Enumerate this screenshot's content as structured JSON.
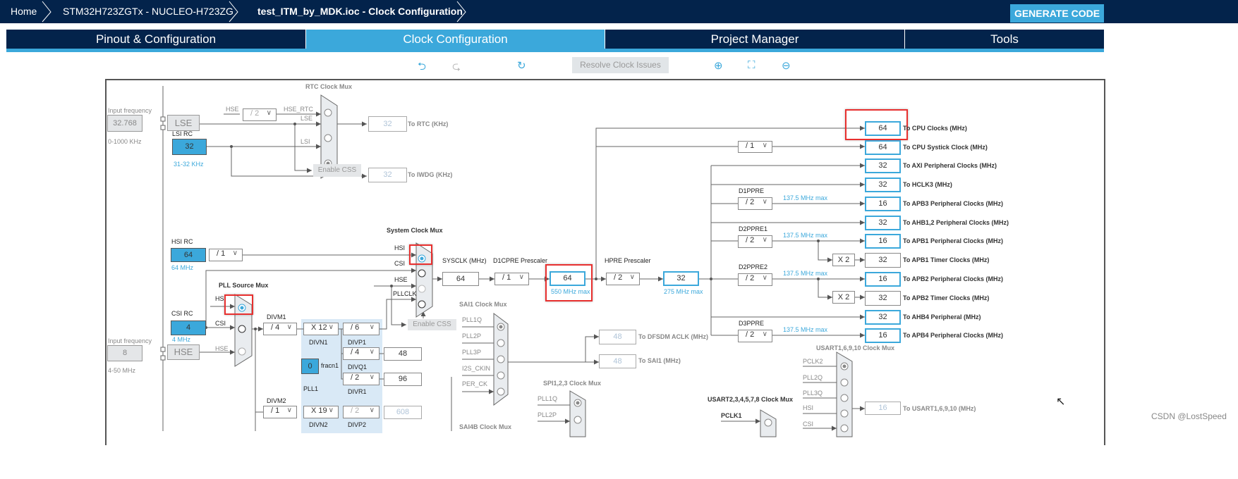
{
  "breadcrumb": [
    "Home",
    "STM32H723ZGTx  -  NUCLEO-H723ZG",
    "test_ITM_by_MDK.ioc - Clock Configuration"
  ],
  "generate_label": "GENERATE CODE",
  "tabs": [
    "Pinout & Configuration",
    "Clock Configuration",
    "Project Manager",
    "Tools"
  ],
  "active_tab": "Clock Configuration",
  "toolbar": {
    "resolve": "Resolve Clock Issues",
    "icons": [
      "undo-icon",
      "redo-icon",
      "refresh-icon",
      "zoom-in-icon",
      "fit-icon",
      "zoom-out-icon"
    ]
  },
  "colors": {
    "navy": "#03234b",
    "accent": "#3ba8db",
    "highlight": "#e8302f"
  },
  "lse": {
    "input_label": "Input frequency",
    "input": "32.768",
    "range": "0-1000 KHz",
    "name": "LSE"
  },
  "lsi": {
    "label": "LSI RC",
    "value": "32",
    "range": "31-32 KHz"
  },
  "rtc": {
    "title": "RTC Clock Mux",
    "hse": "HSE",
    "div": "/ 2",
    "hse_rtc": "HSE_RTC",
    "lse": "LSE",
    "lsi": "LSI",
    "css": "Enable CSS",
    "rtc_val": "32",
    "rtc_label": "To RTC (KHz)",
    "iwdg_val": "32",
    "iwdg_label": "To IWDG (KHz)"
  },
  "hsi": {
    "label": "HSI RC",
    "value": "64",
    "range": "64 MHz",
    "div": "/ 1"
  },
  "csi": {
    "label": "CSI RC",
    "value": "4",
    "range": "4 MHz"
  },
  "hse": {
    "input_label": "Input frequency",
    "input": "8",
    "range": "4-50 MHz",
    "name": "HSE",
    "line": "HSE"
  },
  "pllmux": {
    "title": "PLL Source Mux",
    "in": [
      "HS",
      "CSI",
      "HSE"
    ]
  },
  "sysmux": {
    "title": "System Clock Mux",
    "in": [
      "HSI",
      "CSI",
      "HSE",
      "PLLCLK"
    ],
    "css": "Enable CSS"
  },
  "pll1": {
    "divm_label": "DIVM1",
    "divm": "/ 4",
    "divn": "X 12",
    "divn_label": "DIVN1",
    "divp": "/ 6",
    "divp_label": "DIVP1",
    "divq": "/ 4",
    "divq_label": "DIVQ1",
    "q_out": "48",
    "divr": "/ 2",
    "divr_label": "DIVR1",
    "r_out": "96",
    "fracn": "0",
    "fracn_label": "fracn1",
    "name": "PLL1"
  },
  "pll2": {
    "divm_label": "DIVM2",
    "divm": "/ 1",
    "divn": "X 19",
    "divn_label": "DIVN2",
    "divp": "/ 2",
    "divp_label": "DIVP2",
    "p_out": "608"
  },
  "sys": {
    "sysclk_label": "SYSCLK (MHz)",
    "sysclk": "64",
    "d1cpre_label": "D1CPRE Prescaler",
    "d1cpre": "/ 1",
    "d1_out": "64",
    "d1_max": "550 MHz max",
    "hpre_label": "HPRE Prescaler",
    "hpre": "/ 2",
    "hpre_out": "32",
    "hpre_max": "275 MHz max"
  },
  "outputs": [
    {
      "value": "64",
      "label": "To CPU Clocks (MHz)"
    },
    {
      "value": "64",
      "label": "To CPU Systick Clock (MHz)"
    },
    {
      "value": "32",
      "label": "To AXI Peripheral Clocks (MHz)"
    },
    {
      "value": "32",
      "label": "To HCLK3 (MHz)"
    },
    {
      "value": "16",
      "label": "To APB3 Peripheral Clocks (MHz)"
    },
    {
      "value": "32",
      "label": "To AHB1,2 Peripheral Clocks (MHz)"
    },
    {
      "value": "16",
      "label": "To APB1 Peripheral Clocks (MHz)"
    },
    {
      "value": "32",
      "label": "To APB1 Timer Clocks (MHz)"
    },
    {
      "value": "16",
      "label": "To APB2 Peripheral Clocks (MHz)"
    },
    {
      "value": "32",
      "label": "To APB2 Timer Clocks (MHz)"
    },
    {
      "value": "32",
      "label": "To AHB4 Peripheral (MHz)"
    },
    {
      "value": "16",
      "label": "To APB4 Peripheral Clocks (MHz)"
    }
  ],
  "prescalers": {
    "systick": "/ 1",
    "d1ppre_label": "D1PPRE",
    "d1ppre": "/ 2",
    "d2ppre1_label": "D2PPRE1",
    "d2ppre1": "/ 2",
    "d2ppre2_label": "D2PPRE2",
    "d2ppre2": "/ 2",
    "d3ppre_label": "D3PPRE",
    "d3ppre": "/ 2",
    "max": "137.5 MHz max",
    "x2": "X 2"
  },
  "sai1": {
    "title": "SAI1 Clock Mux",
    "in": [
      "PLL1Q",
      "PLL2P",
      "PLL3P",
      "I2S_CKIN",
      "PER_CK"
    ],
    "dfsdm_val": "48",
    "dfsdm_label": "To DFSDM ACLK (MHz)",
    "sai_val": "48",
    "sai_label": "To SAI1 (MHz)"
  },
  "spi": {
    "title": "SPI1,2,3 Clock Mux",
    "in": [
      "PLL1Q",
      "PLL2P"
    ]
  },
  "sai4b": {
    "title": "SAI4B Clock Mux"
  },
  "usart2": {
    "title": "USART2,3,4,5,7,8 Clock Mux",
    "in": [
      "PCLK1"
    ]
  },
  "usart1": {
    "title": "USART1,6,9,10 Clock Mux",
    "in": [
      "PCLK2",
      "PLL2Q",
      "PLL3Q",
      "HSI",
      "CSI"
    ],
    "value": "16",
    "label": "To USART1,6,9,10 (MHz)"
  },
  "watermark": "CSDN @LostSpeed"
}
